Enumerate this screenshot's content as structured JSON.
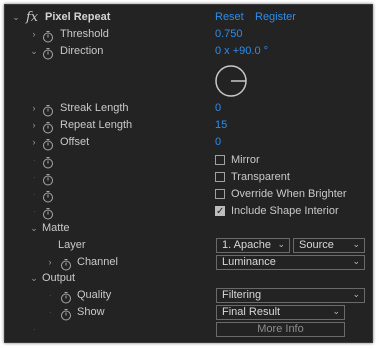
{
  "header": {
    "fx_label": "fx",
    "effect_name": "Pixel Repeat",
    "reset_label": "Reset",
    "register_label": "Register"
  },
  "params": {
    "threshold": {
      "label": "Threshold",
      "value": "0.750"
    },
    "direction": {
      "label": "Direction",
      "value": "0 x +90.0 °",
      "angle_degrees": 90
    },
    "streak_length": {
      "label": "Streak Length",
      "value": "0"
    },
    "repeat_length": {
      "label": "Repeat Length",
      "value": "15"
    },
    "offset": {
      "label": "Offset",
      "value": "0"
    }
  },
  "checkboxes": [
    {
      "label": "Mirror",
      "checked": false
    },
    {
      "label": "Transparent",
      "checked": false
    },
    {
      "label": "Override When Brighter",
      "checked": false
    },
    {
      "label": "Include Shape Interior",
      "checked": true
    }
  ],
  "matte": {
    "group_label": "Matte",
    "layer_label": "Layer",
    "layer_value": "1. Apache",
    "source_value": "Source",
    "channel_label": "Channel",
    "channel_value": "Luminance"
  },
  "output": {
    "group_label": "Output",
    "quality_label": "Quality",
    "quality_value": "Filtering",
    "show_label": "Show",
    "show_value": "Final Result"
  },
  "more_info_label": "More Info",
  "colors": {
    "panel_bg": "#232323",
    "accent_blue": "#2d8ceb",
    "text": "#c9c9c9"
  }
}
